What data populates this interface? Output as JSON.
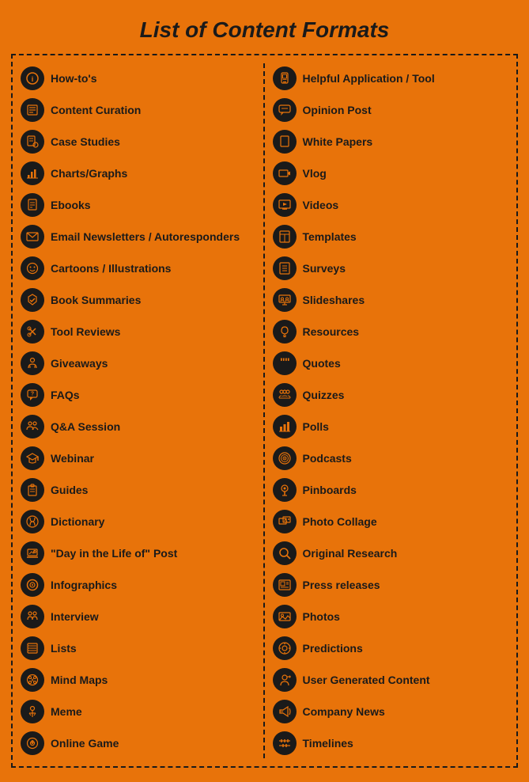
{
  "title": "List of Content Formats",
  "left_column": [
    {
      "label": "How-to's",
      "icon": "ℹ"
    },
    {
      "label": "Content Curation",
      "icon": "✏"
    },
    {
      "label": "Case Studies",
      "icon": "📋"
    },
    {
      "label": "Charts/Graphs",
      "icon": "📈"
    },
    {
      "label": "Ebooks",
      "icon": "📖"
    },
    {
      "label": "Email Newsletters / Autoresponders",
      "icon": "✉"
    },
    {
      "label": "Cartoons / Illustrations",
      "icon": "🎨"
    },
    {
      "label": "Book Summaries",
      "icon": "✔"
    },
    {
      "label": "Tool Reviews",
      "icon": "✂"
    },
    {
      "label": "Giveaways",
      "icon": "🎁"
    },
    {
      "label": "FAQs",
      "icon": "💬"
    },
    {
      "label": "Q&A Session",
      "icon": "👥"
    },
    {
      "label": "Webinar",
      "icon": "🎓"
    },
    {
      "label": "Guides",
      "icon": "📋"
    },
    {
      "label": "Dictionary",
      "icon": "📒"
    },
    {
      "label": "\"Day in the Life of\" Post",
      "icon": "💻"
    },
    {
      "label": "Infographics",
      "icon": "🔵"
    },
    {
      "label": "Interview",
      "icon": "👤"
    },
    {
      "label": "Lists",
      "icon": "📝"
    },
    {
      "label": "Mind Maps",
      "icon": "🧠"
    },
    {
      "label": "Meme",
      "icon": "🏳"
    },
    {
      "label": "Online Game",
      "icon": "🎮"
    }
  ],
  "right_column": [
    {
      "label": "Helpful Application / Tool",
      "icon": "📱"
    },
    {
      "label": "Opinion Post",
      "icon": "💬"
    },
    {
      "label": "White Papers",
      "icon": "📄"
    },
    {
      "label": "Vlog",
      "icon": "📷"
    },
    {
      "label": "Videos",
      "icon": "🖥"
    },
    {
      "label": "Templates",
      "icon": "📋"
    },
    {
      "label": "Surveys",
      "icon": "📊"
    },
    {
      "label": "Slideshares",
      "icon": "👥"
    },
    {
      "label": "Resources",
      "icon": "💡"
    },
    {
      "label": "Quotes",
      "icon": "❝"
    },
    {
      "label": "Quizzes",
      "icon": "👥"
    },
    {
      "label": "Polls",
      "icon": "📊"
    },
    {
      "label": "Podcasts",
      "icon": "🎙"
    },
    {
      "label": "Pinboards",
      "icon": "📌"
    },
    {
      "label": "Photo Collage",
      "icon": "🖼"
    },
    {
      "label": "Original Research",
      "icon": "🔍"
    },
    {
      "label": "Press releases",
      "icon": "📰"
    },
    {
      "label": "Photos",
      "icon": "🏔"
    },
    {
      "label": "Predictions",
      "icon": "⚙"
    },
    {
      "label": "User Generated Content",
      "icon": "👤"
    },
    {
      "label": "Company News",
      "icon": "📢"
    },
    {
      "label": "Timelines",
      "icon": "≡"
    }
  ],
  "icons": {
    "how-tos": "ℹ️",
    "content-curation": "📝",
    "case-studies": "🗂",
    "charts": "📈",
    "ebooks": "📚",
    "email": "✉️",
    "cartoons": "🎨",
    "book-summaries": "📖",
    "tool-reviews": "✂️",
    "giveaways": "🎁",
    "faqs": "💬",
    "qa": "👥",
    "webinar": "🎓",
    "guides": "📋",
    "dictionary": "📒",
    "day-in-life": "💻",
    "infographics": "🔵",
    "interview": "👤",
    "lists": "📝",
    "mind-maps": "🧠",
    "meme": "🏳️",
    "online-game": "🎮"
  }
}
